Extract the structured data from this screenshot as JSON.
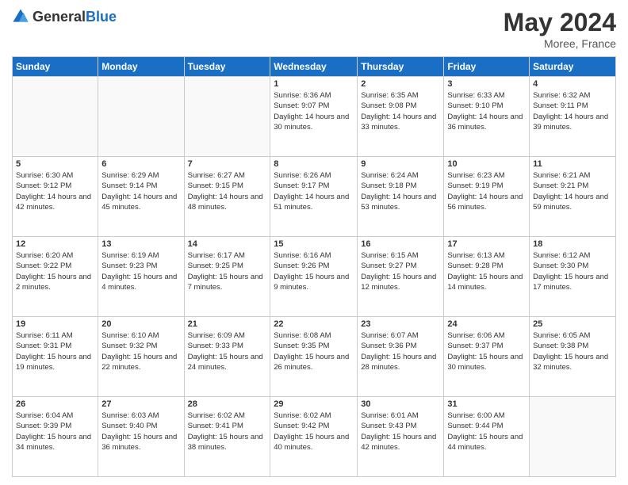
{
  "header": {
    "logo_general": "General",
    "logo_blue": "Blue",
    "title": "May 2024",
    "location": "Moree, France"
  },
  "days_of_week": [
    "Sunday",
    "Monday",
    "Tuesday",
    "Wednesday",
    "Thursday",
    "Friday",
    "Saturday"
  ],
  "weeks": [
    [
      {
        "day": "",
        "sunrise": "",
        "sunset": "",
        "daylight": ""
      },
      {
        "day": "",
        "sunrise": "",
        "sunset": "",
        "daylight": ""
      },
      {
        "day": "",
        "sunrise": "",
        "sunset": "",
        "daylight": ""
      },
      {
        "day": "1",
        "sunrise": "Sunrise: 6:36 AM",
        "sunset": "Sunset: 9:07 PM",
        "daylight": "Daylight: 14 hours and 30 minutes."
      },
      {
        "day": "2",
        "sunrise": "Sunrise: 6:35 AM",
        "sunset": "Sunset: 9:08 PM",
        "daylight": "Daylight: 14 hours and 33 minutes."
      },
      {
        "day": "3",
        "sunrise": "Sunrise: 6:33 AM",
        "sunset": "Sunset: 9:10 PM",
        "daylight": "Daylight: 14 hours and 36 minutes."
      },
      {
        "day": "4",
        "sunrise": "Sunrise: 6:32 AM",
        "sunset": "Sunset: 9:11 PM",
        "daylight": "Daylight: 14 hours and 39 minutes."
      }
    ],
    [
      {
        "day": "5",
        "sunrise": "Sunrise: 6:30 AM",
        "sunset": "Sunset: 9:12 PM",
        "daylight": "Daylight: 14 hours and 42 minutes."
      },
      {
        "day": "6",
        "sunrise": "Sunrise: 6:29 AM",
        "sunset": "Sunset: 9:14 PM",
        "daylight": "Daylight: 14 hours and 45 minutes."
      },
      {
        "day": "7",
        "sunrise": "Sunrise: 6:27 AM",
        "sunset": "Sunset: 9:15 PM",
        "daylight": "Daylight: 14 hours and 48 minutes."
      },
      {
        "day": "8",
        "sunrise": "Sunrise: 6:26 AM",
        "sunset": "Sunset: 9:17 PM",
        "daylight": "Daylight: 14 hours and 51 minutes."
      },
      {
        "day": "9",
        "sunrise": "Sunrise: 6:24 AM",
        "sunset": "Sunset: 9:18 PM",
        "daylight": "Daylight: 14 hours and 53 minutes."
      },
      {
        "day": "10",
        "sunrise": "Sunrise: 6:23 AM",
        "sunset": "Sunset: 9:19 PM",
        "daylight": "Daylight: 14 hours and 56 minutes."
      },
      {
        "day": "11",
        "sunrise": "Sunrise: 6:21 AM",
        "sunset": "Sunset: 9:21 PM",
        "daylight": "Daylight: 14 hours and 59 minutes."
      }
    ],
    [
      {
        "day": "12",
        "sunrise": "Sunrise: 6:20 AM",
        "sunset": "Sunset: 9:22 PM",
        "daylight": "Daylight: 15 hours and 2 minutes."
      },
      {
        "day": "13",
        "sunrise": "Sunrise: 6:19 AM",
        "sunset": "Sunset: 9:23 PM",
        "daylight": "Daylight: 15 hours and 4 minutes."
      },
      {
        "day": "14",
        "sunrise": "Sunrise: 6:17 AM",
        "sunset": "Sunset: 9:25 PM",
        "daylight": "Daylight: 15 hours and 7 minutes."
      },
      {
        "day": "15",
        "sunrise": "Sunrise: 6:16 AM",
        "sunset": "Sunset: 9:26 PM",
        "daylight": "Daylight: 15 hours and 9 minutes."
      },
      {
        "day": "16",
        "sunrise": "Sunrise: 6:15 AM",
        "sunset": "Sunset: 9:27 PM",
        "daylight": "Daylight: 15 hours and 12 minutes."
      },
      {
        "day": "17",
        "sunrise": "Sunrise: 6:13 AM",
        "sunset": "Sunset: 9:28 PM",
        "daylight": "Daylight: 15 hours and 14 minutes."
      },
      {
        "day": "18",
        "sunrise": "Sunrise: 6:12 AM",
        "sunset": "Sunset: 9:30 PM",
        "daylight": "Daylight: 15 hours and 17 minutes."
      }
    ],
    [
      {
        "day": "19",
        "sunrise": "Sunrise: 6:11 AM",
        "sunset": "Sunset: 9:31 PM",
        "daylight": "Daylight: 15 hours and 19 minutes."
      },
      {
        "day": "20",
        "sunrise": "Sunrise: 6:10 AM",
        "sunset": "Sunset: 9:32 PM",
        "daylight": "Daylight: 15 hours and 22 minutes."
      },
      {
        "day": "21",
        "sunrise": "Sunrise: 6:09 AM",
        "sunset": "Sunset: 9:33 PM",
        "daylight": "Daylight: 15 hours and 24 minutes."
      },
      {
        "day": "22",
        "sunrise": "Sunrise: 6:08 AM",
        "sunset": "Sunset: 9:35 PM",
        "daylight": "Daylight: 15 hours and 26 minutes."
      },
      {
        "day": "23",
        "sunrise": "Sunrise: 6:07 AM",
        "sunset": "Sunset: 9:36 PM",
        "daylight": "Daylight: 15 hours and 28 minutes."
      },
      {
        "day": "24",
        "sunrise": "Sunrise: 6:06 AM",
        "sunset": "Sunset: 9:37 PM",
        "daylight": "Daylight: 15 hours and 30 minutes."
      },
      {
        "day": "25",
        "sunrise": "Sunrise: 6:05 AM",
        "sunset": "Sunset: 9:38 PM",
        "daylight": "Daylight: 15 hours and 32 minutes."
      }
    ],
    [
      {
        "day": "26",
        "sunrise": "Sunrise: 6:04 AM",
        "sunset": "Sunset: 9:39 PM",
        "daylight": "Daylight: 15 hours and 34 minutes."
      },
      {
        "day": "27",
        "sunrise": "Sunrise: 6:03 AM",
        "sunset": "Sunset: 9:40 PM",
        "daylight": "Daylight: 15 hours and 36 minutes."
      },
      {
        "day": "28",
        "sunrise": "Sunrise: 6:02 AM",
        "sunset": "Sunset: 9:41 PM",
        "daylight": "Daylight: 15 hours and 38 minutes."
      },
      {
        "day": "29",
        "sunrise": "Sunrise: 6:02 AM",
        "sunset": "Sunset: 9:42 PM",
        "daylight": "Daylight: 15 hours and 40 minutes."
      },
      {
        "day": "30",
        "sunrise": "Sunrise: 6:01 AM",
        "sunset": "Sunset: 9:43 PM",
        "daylight": "Daylight: 15 hours and 42 minutes."
      },
      {
        "day": "31",
        "sunrise": "Sunrise: 6:00 AM",
        "sunset": "Sunset: 9:44 PM",
        "daylight": "Daylight: 15 hours and 44 minutes."
      },
      {
        "day": "",
        "sunrise": "",
        "sunset": "",
        "daylight": ""
      }
    ]
  ]
}
